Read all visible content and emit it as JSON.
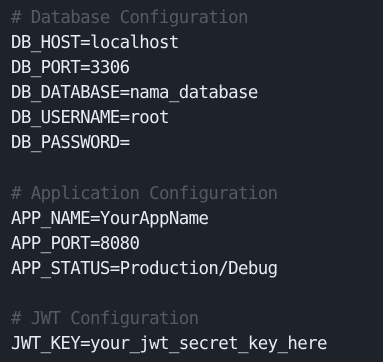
{
  "editor": {
    "colors": {
      "background": "#1e2229",
      "comment": "#545b67",
      "text": "#e9ecf2"
    },
    "lines": [
      {
        "type": "comment",
        "text": "# Database Configuration"
      },
      {
        "type": "code",
        "text": "DB_HOST=localhost"
      },
      {
        "type": "code",
        "text": "DB_PORT=3306"
      },
      {
        "type": "code",
        "text": "DB_DATABASE=nama_database"
      },
      {
        "type": "code",
        "text": "DB_USERNAME=root"
      },
      {
        "type": "code",
        "text": "DB_PASSWORD="
      },
      {
        "type": "blank",
        "text": ""
      },
      {
        "type": "comment",
        "text": "# Application Configuration"
      },
      {
        "type": "code",
        "text": "APP_NAME=YourAppName"
      },
      {
        "type": "code",
        "text": "APP_PORT=8080"
      },
      {
        "type": "code",
        "text": "APP_STATUS=Production/Debug"
      },
      {
        "type": "blank",
        "text": ""
      },
      {
        "type": "comment",
        "text": "# JWT Configuration"
      },
      {
        "type": "code",
        "text": "JWT_KEY=your_jwt_secret_key_here"
      }
    ]
  }
}
